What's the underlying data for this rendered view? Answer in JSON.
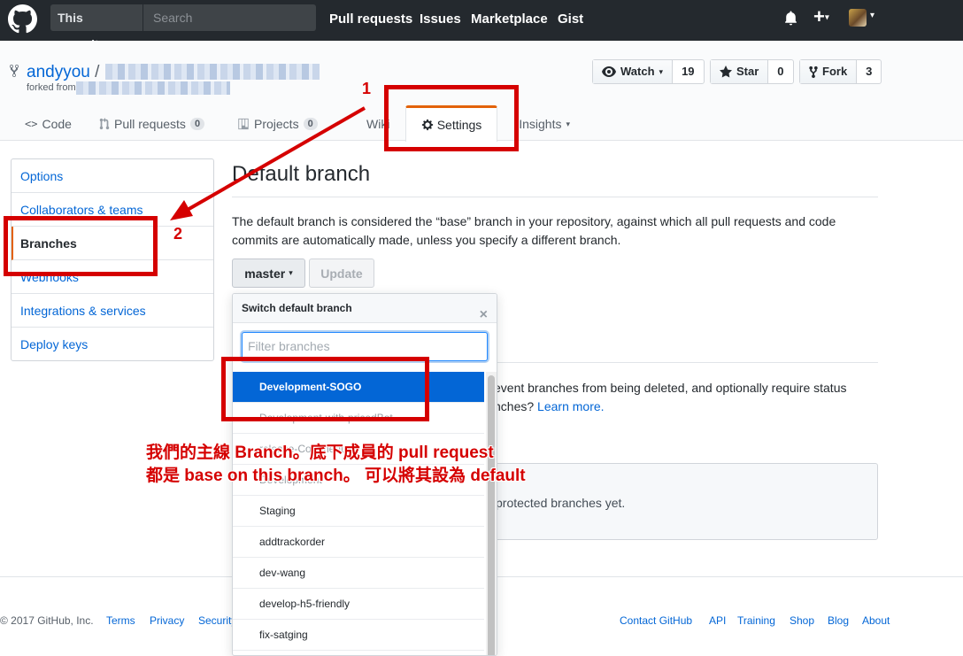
{
  "header": {
    "scope_label": "This repository",
    "search_placeholder": "Search",
    "nav": [
      "Pull requests",
      "Issues",
      "Marketplace",
      "Gist"
    ],
    "plus": "+"
  },
  "repo": {
    "owner": "andyyou",
    "separator": "/",
    "forked_from_label": "forked from",
    "watch_label": "Watch",
    "watch_count": "19",
    "star_label": "Star",
    "star_count": "0",
    "fork_label": "Fork",
    "fork_count": "3"
  },
  "tabs": [
    {
      "label": "Code"
    },
    {
      "label": "Pull requests",
      "count": "0"
    },
    {
      "label": "Projects",
      "count": "0"
    },
    {
      "label": "Wiki"
    },
    {
      "label": "Settings"
    },
    {
      "label": "Insights"
    }
  ],
  "sidebar": {
    "items": [
      "Options",
      "Collaborators & teams",
      "Branches",
      "Webhooks",
      "Integrations & services",
      "Deploy keys"
    ],
    "selected": "Branches"
  },
  "main": {
    "heading": "Default branch",
    "description": "The default branch is considered the “base” branch in your repository, against which all pull requests and code commits are automatically made, unless you specify a different branch.",
    "branch_button": "master",
    "update_button": "Update",
    "protected_text_1": "event branches from being deleted, and optionally require status",
    "protected_text_2": "nches?",
    "learn_more": "Learn more.",
    "no_protected": "protected branches yet."
  },
  "dropdown": {
    "title": "Switch default branch",
    "close": "×",
    "filter_placeholder": "Filter branches",
    "branches": [
      "Development-SOGO",
      "Development-with-pricedBot",
      "release-Comment",
      "Development",
      "Staging",
      "addtrackorder",
      "dev-wang",
      "develop-h5-friendly",
      "fix-satging"
    ],
    "active_index": 0
  },
  "footer": {
    "copyright": "© 2017 GitHub, Inc.",
    "left_links": [
      "Terms",
      "Privacy",
      "Security"
    ],
    "right_links": [
      "Contact GitHub",
      "API",
      "Training",
      "Shop",
      "Blog",
      "About"
    ]
  },
  "annotations": {
    "step1": "1",
    "step2": "2",
    "note_line1": "我們的主線 Branch。底下成員的 pull request",
    "note_line2": "都是 base on this branch。 可以將其設為 default",
    "color": "#d50000"
  }
}
